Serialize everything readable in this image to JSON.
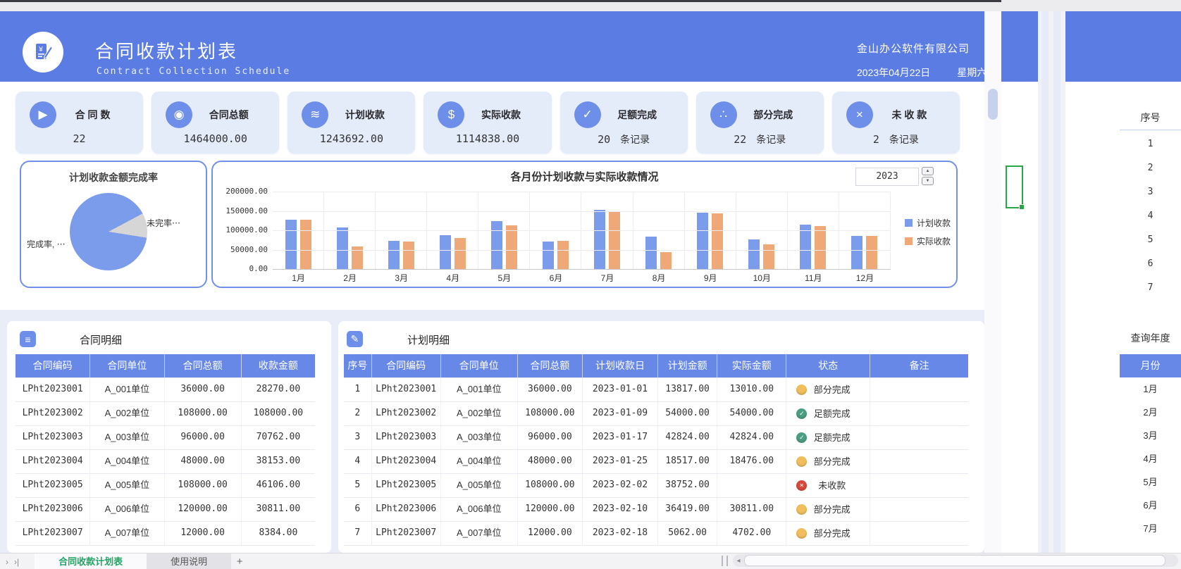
{
  "header": {
    "title": "合同收款计划表",
    "subtitle": "Contract Collection Schedule",
    "company": "金山办公软件有限公司",
    "date": "2023年04月22日",
    "weekday": "星期六",
    "accent_color": "#5B7CE2"
  },
  "kpis": [
    {
      "icon": "play-icon",
      "glyph": "▶",
      "label": "合 同 数",
      "value": "22",
      "suffix": ""
    },
    {
      "icon": "medal-icon",
      "glyph": "◉",
      "label": "合同总额",
      "value": "1464000.00",
      "suffix": ""
    },
    {
      "icon": "coins-icon",
      "glyph": "≋",
      "label": "计划收款",
      "value": "1243692.00",
      "suffix": ""
    },
    {
      "icon": "dollar-icon",
      "glyph": "$",
      "label": "实际收款",
      "value": "1114838.00",
      "suffix": ""
    },
    {
      "icon": "check-icon",
      "glyph": "✓",
      "label": "足额完成",
      "value": "20",
      "suffix": "条记录"
    },
    {
      "icon": "share-icon",
      "glyph": "∴",
      "label": "部分完成",
      "value": "22",
      "suffix": "条记录"
    },
    {
      "icon": "cross-icon",
      "glyph": "×",
      "label": "未 收 款",
      "value": "2",
      "suffix": "条记录"
    }
  ],
  "charts": {
    "pie": {
      "title": "计划收款金额完成率",
      "label_left": "完成率, ⋯",
      "label_right": "未完率⋯"
    },
    "bar": {
      "title": "各月份计划收款与实际收款情况",
      "year": "2023",
      "yticks": [
        "200000.00",
        "150000.00",
        "100000.00",
        "50000.00",
        "0.00"
      ],
      "legend": [
        "计划收款",
        "实际收款"
      ],
      "colors": {
        "plan": "#7B9CEB",
        "actual": "#EFA877"
      }
    }
  },
  "chart_data": [
    {
      "type": "pie",
      "title": "计划收款金额完成率",
      "labels": [
        "完成率",
        "未完率"
      ],
      "values": [
        89.6,
        10.4
      ],
      "colors": [
        "#7B9CEB",
        "#D6D6D6"
      ],
      "legend_position": "none"
    },
    {
      "type": "bar",
      "title": "各月份计划收款与实际收款情况",
      "categories": [
        "1月",
        "2月",
        "3月",
        "4月",
        "5月",
        "6月",
        "7月",
        "8月",
        "9月",
        "10月",
        "11月",
        "12月"
      ],
      "series": [
        {
          "name": "计划收款",
          "color": "#7B9CEB",
          "values": [
            128000,
            107000,
            73000,
            88000,
            123000,
            71000,
            153000,
            84000,
            145000,
            77000,
            114000,
            85000
          ]
        },
        {
          "name": "实际收款",
          "color": "#EFA877",
          "values": [
            127000,
            59000,
            70000,
            80000,
            113000,
            73000,
            147000,
            43000,
            143000,
            63000,
            111000,
            85000
          ]
        }
      ],
      "ylim": [
        0,
        200000
      ],
      "grid": true,
      "legend_position": "right"
    }
  ],
  "contract_table": {
    "icon": "list-icon",
    "icon_glyph": "≡",
    "title": "合同明细",
    "headers": [
      "合同编码",
      "合同单位",
      "合同总额",
      "收款金额"
    ],
    "rows": [
      [
        "LPht2023001",
        "A_001单位",
        "36000.00",
        "28270.00"
      ],
      [
        "LPht2023002",
        "A_002单位",
        "108000.00",
        "108000.00"
      ],
      [
        "LPht2023003",
        "A_003单位",
        "96000.00",
        "70762.00"
      ],
      [
        "LPht2023004",
        "A_004单位",
        "48000.00",
        "38153.00"
      ],
      [
        "LPht2023005",
        "A_005单位",
        "108000.00",
        "46106.00"
      ],
      [
        "LPht2023006",
        "A_006单位",
        "120000.00",
        "30811.00"
      ],
      [
        "LPht2023007",
        "A_007单位",
        "12000.00",
        "8384.00"
      ]
    ]
  },
  "plan_table": {
    "icon": "edit-doc-icon",
    "icon_glyph": "✓",
    "title": "计划明细",
    "headers": [
      "序号",
      "合同编码",
      "合同单位",
      "合同总额",
      "计划收款日",
      "计划金额",
      "实际金额",
      "状态",
      "备注"
    ],
    "rows": [
      {
        "seq": "1",
        "code": "LPht2023001",
        "unit": "A_001单位",
        "total": "36000.00",
        "date": "2023-01-01",
        "plan": "13817.00",
        "actual": "13010.00",
        "status": "部分完成",
        "status_type": "partial",
        "remark": ""
      },
      {
        "seq": "2",
        "code": "LPht2023002",
        "unit": "A_002单位",
        "total": "108000.00",
        "date": "2023-01-09",
        "plan": "54000.00",
        "actual": "54000.00",
        "status": "足额完成",
        "status_type": "full",
        "remark": ""
      },
      {
        "seq": "3",
        "code": "LPht2023003",
        "unit": "A_003单位",
        "total": "96000.00",
        "date": "2023-01-17",
        "plan": "42824.00",
        "actual": "42824.00",
        "status": "足额完成",
        "status_type": "full",
        "remark": ""
      },
      {
        "seq": "4",
        "code": "LPht2023004",
        "unit": "A_004单位",
        "total": "48000.00",
        "date": "2023-01-25",
        "plan": "18517.00",
        "actual": "18476.00",
        "status": "部分完成",
        "status_type": "partial",
        "remark": ""
      },
      {
        "seq": "5",
        "code": "LPht2023005",
        "unit": "A_005单位",
        "total": "108000.00",
        "date": "2023-02-02",
        "plan": "38752.00",
        "actual": "",
        "status": "未收款",
        "status_type": "none",
        "remark": ""
      },
      {
        "seq": "6",
        "code": "LPht2023006",
        "unit": "A_006单位",
        "total": "120000.00",
        "date": "2023-02-10",
        "plan": "36419.00",
        "actual": "30811.00",
        "status": "部分完成",
        "status_type": "partial",
        "remark": ""
      },
      {
        "seq": "7",
        "code": "LPht2023007",
        "unit": "A_007单位",
        "total": "12000.00",
        "date": "2023-02-18",
        "plan": "5062.00",
        "actual": "4702.00",
        "status": "部分完成",
        "status_type": "partial",
        "remark": ""
      }
    ]
  },
  "status_styles": {
    "partial": {
      "color": "#F0BE5C",
      "glyph": ""
    },
    "full": {
      "color": "#4B9E82",
      "glyph": "✓"
    },
    "none": {
      "color": "#D8483D",
      "glyph": "×"
    }
  },
  "right_panel": {
    "col_header": "序号",
    "numbers": [
      "1",
      "2",
      "3",
      "4",
      "5",
      "6",
      "7"
    ],
    "year_label": "查询年度",
    "month_header": "月份",
    "months": [
      "1月",
      "2月",
      "3月",
      "4月",
      "5月",
      "6月",
      "7月"
    ]
  },
  "sheet_bar": {
    "nav": [
      "›",
      "›|"
    ],
    "tabs": [
      {
        "label": "合同收款计划表",
        "active": true
      },
      {
        "label": "使用说明",
        "active": false
      }
    ],
    "add_label": "+"
  }
}
